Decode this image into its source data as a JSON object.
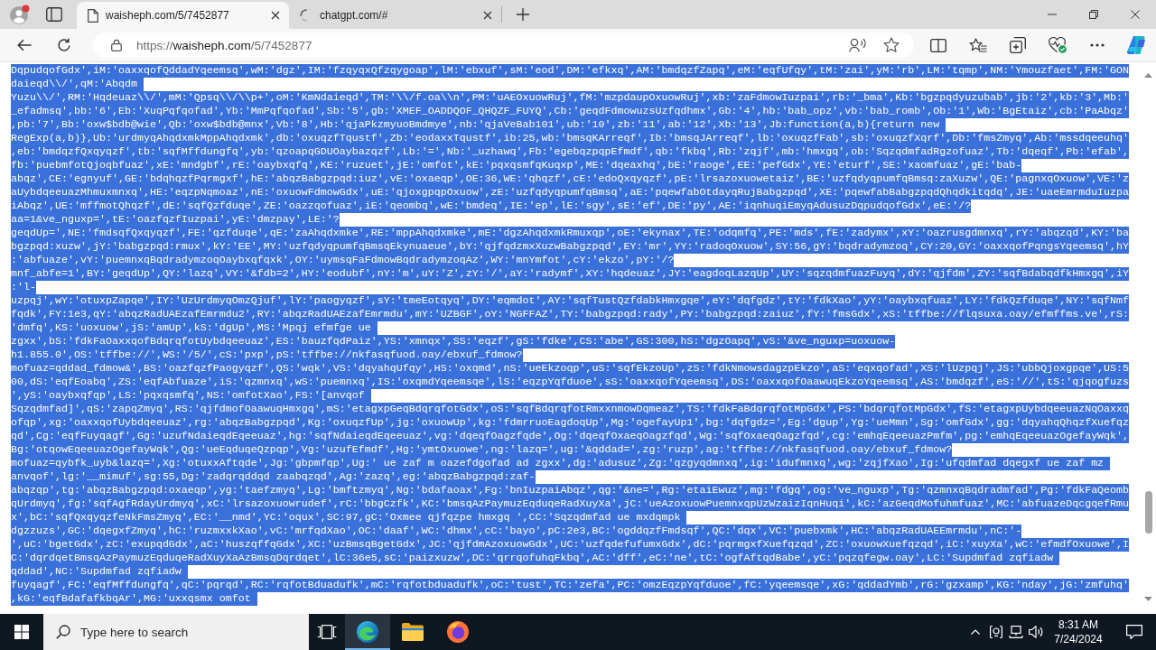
{
  "browser": {
    "tabs": [
      {
        "title": "waisheph.com/5/7452877",
        "selected": true,
        "kind": "page"
      },
      {
        "title": "chatgpt.com/#",
        "selected": false,
        "kind": "loading"
      }
    ],
    "address": {
      "scheme": "https://",
      "host": "waisheph.com",
      "path": "/5/7452877"
    }
  },
  "page": {
    "selected": true,
    "lines": [
      "DqpudqofGdx',iM:'oaxxqofQddadYqeemsq',wM:'dgz',IM:'fzqyqxQfzqygoap',lM:'ebxuf',sM:'eod',DM:'efkxq',AM:'bmdqzfZapq',eM:'eqfUfqy',tM:'zai',yM:'rb',LM:'tqmp',NM:'Ymouzfaet',FM:'GON",
      "daieqd\\\\/',qM:'Abqdm ",
      "Yuzu\\\\/',RM:'Hqdeuaz\\\\/',mM:'Qpsq\\\\/\\\\p+',oM:'KmNdaieqd',TM:'\\\\/f.oa\\\\n',PM:'uAEOxuowRuj',fM:'mzpdaupOxuowRuj',xb:'zaFdmowIuzpai',rb:'_bma',Kb:'bgzpqdyuzubab',jb:'2',kb:'3',Mb:'",
      "_efadmsq',bb:'6',Eb:'XuqPqfqofad',Yb:'MmPqfqofad',Sb:'5',gb:'XMEF_OADDQOF_QHQZF_FUYQ',Cb:'geqdFdmowuzsUzfqdhmx',Gb:'4',hb:'bab_opz',vb:'bab_romb',Ob:'1',Wb:'BgEtaiz',cb:'PaAbqz'",
      ",pb:'7',Bb:'oxw$bdb@wie',Qb:'oxw$bdb@mnx',Vb:'8',Hb:'qjaPkzmyuoBmdmye',nb:'qjaVeBab101',ub:'10',zb:'11',ab:'12',Xb:'13',Jb:function(a,b){return new ",
      "RegExp(a,b)},Ub:'urdmyqAhqdxmkMppAhqdxmk',db:'oxuqzfTqustf',Zb:'eodaxxTqustf',ib:25,wb:'bmsqKArreqf',Ib:'bmsqJArreqf',lb:'oxuqzfFab',sb:'oxuqzfXqrf',Db:'fmsZmyq',Ab:'mssdqeeuhq'",
      ",eb:'bmdqzfQxqyqzf',tb:'sqfMffdungfq',yb:'qzoapqGDUOaybazqzf',Lb:'=',Nb:'_uzhawq',Fb:'egebqzpqpEfmdf',qb:'fkbq',Rb:'zqjf',mb:'hmxgq',ob:'SqzqdmfadRgzofuaz',Tb:'dqeqf',Pb:'efab',",
      "fb:'puebmfotQjoqbfuaz',xE:'mndgbf',rE:'oaybxqfq',KE:'ruzuet',jE:'omfot',kE:'pqxqsmfqKuqxp',ME:'dqeaxhq',bE:'raoge',EE:'pefGdx',YE:'eturf',SE:'xaomfuaz',gE:'bab-",
      "abqz',CE:'egnyuf',GE:'bdqhqzfPqrmgxf',hE:'abqzBabgzpqd:iuz',vE:'oxaeqp',OE:36,WE:'qhqzf',cE:'edoQxqyqzf',pE:'lrsazoxuowetaiz',BE:'uzfqdyqpumfqBmsq:zaXuzw',QE:'pagnxqOxuow',VE:'z",
      "aUybdqeeuazMhmuxmnxq',HE:'eqzpNqmoaz',nE:'oxuowFdmowGdx',uE:'qjoxgpqpOxuow',zE:'uzfqdyqpumfqBmsq',aE:'pqewfabOtdayqRujBabgzpqd',XE:'pqewfabBabgzpqdQhqdkitqdq',JE:'uaeEmrmduIuzpa",
      "iAbqz',UE:'mffmotQhqzf',dE:'sqfQzfduqe',ZE:'oazzqofuaz',iE:'qeombq',wE:'bmdeq',IE:'ep',lE:'sgy',sE:'ef',DE:'py',AE:'iqnhuqiEmyqAdusuzDqpudqofGdx',eE:'/?",
      "aa=1&ve_nguxp=',tE:'oazfqzfIuzpai',yE:'dmzpay',LE:'?",
      "geqdUp=',NE:'fmdsqfQxqyqzf',FE:'qzfduqe',qE:'zaAhqdxmke',RE:'mppAhqdxmke',mE:'dgzAhqdxmkRmuxqp',oE:'ekynax',TE:'odqmfq',PE:'mds',fE:'zadymx',xY:'oazrusgdmnxq',rY:'abqzqd',KY:'ba",
      "bgzpqd:xuzw',jY:'babgzpqd:rmux',kY:'EE',MY:'uzfqdyqpumfqBmsqEkynuaeue',bY:'qjfqdzmxXuzwBabgzpqd',EY:'mr',YY:'radoqOxuow',SY:56,gY:'bqdradymzoq',CY:20,GY:'oaxxqofPqngsYqeemsq',hY",
      ":'abfuaze',vY:'puemnxqBqdradymzoqOaybxqfqxk',OY:'uymsqFaFdmowBqdradymzoqAz',WY:'mnYmfot',cY:'ekzo',pY:'/?",
      "mnf_abfe=1',BY:'geqdUp',QY:'lazq',VY:'&fdb=2',HY:'eodubf',nY:'m',uY:'Z',zY:'/',aY:'radymf',XY:'hqdeuaz',JY:'eagdoqLazqUp',UY:'sqzqdmfuazFuyq',dY:'qjfdm',ZY:'sqfBdabqdfkHmxgq',iY",
      ":'l-",
      "uzpqj',wY:'otuxpZapqe',IY:'UzUrdmyqOmzQjuf',lY:'paogyqzf',sY:'tmeEotqyq',DY:'eqmdot',AY:'sqfTustQzfdabkHmxgqe',eY:'dqfgdz',tY:'fdkXao',yY:'oaybxqfuaz',LY:'fdkQzfduqe',NY:'sqfNmf",
      "fqdk',FY:1e3,qY:'abqzRadUAEzafEmrmdu2',RY:'abqzRadUAEzafEmrmdu',mY:'UZBGF',oY:'NGFFAZ',TY:'babgzpqd:rady',PY:'babgzpqd:zaiuz',fY:'fmsGdx',xS:'tffbe://flqsuxa.oay/efmffms.ve',rS:",
      "'dmfq',KS:'uoxuow',jS:'amUp',kS:'dgUp',MS:'Mpqj efmfge ue ",
      "zgxx',bS:'fdkFaOaxxqofBdqrqfotUybdqeeuaz',ES:'bauzfqdPaiz',YS:'xmnqx',SS:'eqzf',gS:'fdke',CS:'abe',GS:300,hS:'dgzOapq',vS:'&ve_nguxp=uoxuow-",
      "h1.855.0',OS:'tffbe://',WS:'/5/',cS:'pxp',pS:'tffbe://nkfasqfuod.oay/ebxuf_fdmow?",
      "mofuaz=qddad_fdmow&',BS:'oazfqzfPaogyqzf',QS:'wqk',VS:'dqyahqUfqy',HS:'oxqmd',nS:'ueEkzoqp',uS:'sqfEkzoUp',zS:'fdkNmowsdagzpEkzo',aS:'eqxqofad',XS:'lUzpqj',JS:'ubbQjoxgpqe',US:5",
      "00,dS:'eqfEoabq',ZS:'eqfAbfuaze',iS:'qzmnxq',wS:'puemnxq',IS:'oxqmdYqeemsqe',lS:'eqzpYqfduoe',sS:'oaxxqofYqeemsq',DS:'oaxxqofOaawuqEkzoYqeemsq',AS:'bmdqzf',eS:'//',tS:'qjqogfuzs",
      "',yS:'oaybxqfqp',LS:'pqxqsmfq',NS:'omfotXao',FS:'[anvqof ",
      "Sqzqdmfad]',qS:'zapqZmyq',RS:'qjfdmofOaawuqHmxgq',mS:'etagxpGeqBdqrqfotGdx',oS:'sqfBdqrqfotRmxxnmowDqmeaz',TS:'fdkFaBdqrqfotMpGdx',PS:'bdqrqfotMpGdx',fS:'etagxpUybdqeeuazNqOaxxq",
      "ofqp',xg:'oaxxqofUybdqeeuaz',rg:'abqzBabgzpqd',Kg:'oxuqzfUp',jg:'oxuowUp',kg:'fdmrruoEagdoqUp',Mg:'ogefayUp1',bg:'dqfgdz=',Eg:'dgup',Yg:'ueMmn',Sg:'omfGdx',gg:'dqyahqQhqzfXuefqz",
      "qd',Cg:'eqfFuyqagf',Gg:'uzufNdaieqdEqeeuaz',hg:'sqfNdaieqdEqeeuaz',vg:'dqeqfOagzfqde',Og:'dqeqfOxaeqOagzfqd',Wg:'sqfOxaeqOagzfqd',cg:'emhqEqeeuazPmfm',pg:'emhqEqeeuazOgefayWqk',",
      "Bg:'otqowEqeeuazOgefayWqk',Qg:'ueEqduqeQzpqp',Vg:'uzufEfmdf',Hg:'ymtOxuowe',ng:'lazq=',ug:'&qddad=',zg:'ruzp',ag:'tffbe://nkfasqfuod.oay/ebxuf_fdmow?",
      "mofuaz=qybfk_uyb&lazq=',Xg:'otuxxAftqde',Jg:'gbpmfqp',Ug:' ue zaf m oazefdgofad ad zgxx',dg:'adusuz',Zg:'qzgyqdmnxq',ig:'idufmnxq',wg:'zqjfXao',Ig:'ufqdmfad dqegxf ue zaf mz ",
      "anvqof',lg:'__mimuf',sg:55,Dg:'zadqrqddqd zaabqzqd',Ag:'zazq',eg:'abqzBabgzpqd:zaf-",
      "abqzqp',tg:'abqzBabgzpqd:oxaeqp',yg:'taefzmyq',Lg:'bmftzmyq',Ng:'bdafaoax',Fg:'bnIuzpaiAbqz',qg:'&ne=',Rg:'etaiEwuz',mg:'fdgq',og:'ve_nguxp',Tg:'qzmnxqBqdradmfad',Pg:'fdkFaQeomb",
      "qUrdmyq',fg:'sqfAgfRdayUrdmyq',xC:'lrsazoxuowrudef',rC:'bbgCzfk',KC:'bmsqAzPaymuzEqduqeRadXuyXa',jC:'ueAzoxuowPuemnxqpUzWzaizIqnHuqi',kC:'azGeqdMofuhmfuaz',MC:'abfuazeDqcgqefRmu",
      "x',bC:'sqfQxqyqzfeNkFmsZmyq',EC:'__nmd',YC:'oqux',SC:97,gC:'Oxmee qjfqzpe hmxgq ',CC:'Sqzqdmfad ue mxdqmpk ",
      "dgzzuzs',GC:'dqegxfZmyq',hC:'ruzmxxkXao',vC:'mrfqdXao',OC:'daaf',WC:'dhmx',cC:'bayo',pC:2e3,BC:'ogddqzfFmdsqf',QC:'dqx',VC:'puebxmk',HC:'abqzRadUAEEmrmdu',nC:'-",
      "',uC:'bgetGdx',zC:'exupqdGdx',aC:'huszqffqGdx',XC:'uzBmsqBgetGdx',JC:'qjfdmAzoxuowGdx',UC:'uzfqdefufumxGdx',dC:'pqrmgxfXuefqzqd',ZC:'oxuowXuefqzqd',iC:'xuyXa',wC:'efmdfOxuowe',I",
      "C:'dqrdqetBmsqAzPaymuzEqduqeRadXuyXaAzBmsqDqrdqet',lC:36e5,sC:'paizxuzw',DC:'qrrqofuhqFkbq',AC:'dff',eC:'ne',tC:'ogfAftqdBabe',yC:'pqzqfegw.oay',LC:'Supdmfad zqfiadw ",
      "qddad',NC:'Supdmfad zqfiadw ",
      "fuyqagf',FC:'eqfMffdungfq',qC:'pqrqd',RC:'rqfotBduadufk',mC:'rqfotbduadufk',oC:'tust',TC:'zefa',PC:'omzEqzpYqfduoe',fC:'yqeemsqe',xG:'qddadYmb',rG:'gzxamp',KG:'nday',jG:'zmfuhq'",
      ",kG:'eqfBdafafkbqAr',MG:'uxxqsmx omfot "
    ]
  },
  "taskbar": {
    "search": {
      "placeholder": "Type here to search"
    },
    "apps": [
      {
        "kind": "edge",
        "selected": true
      },
      {
        "kind": "explorer",
        "selected": false
      },
      {
        "kind": "firefox",
        "selected": false
      }
    ],
    "time": "8:31 AM",
    "date": "7/24/2024"
  }
}
